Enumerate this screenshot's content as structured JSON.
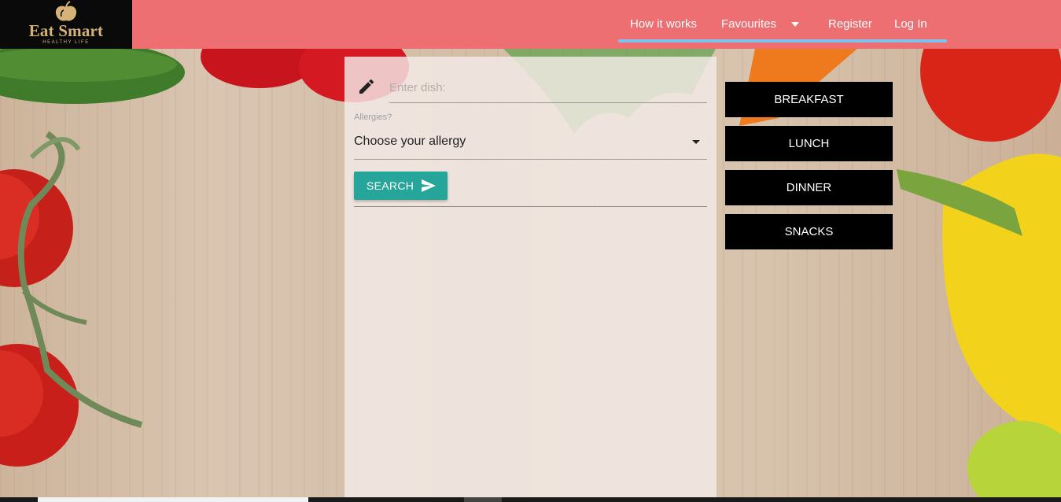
{
  "brand": {
    "name": "Eat Smart",
    "tagline": "HEALTHY LIFE",
    "logo_icon": "apple-icon"
  },
  "nav": {
    "items": [
      {
        "label": "How it works"
      },
      {
        "label": "Favourites",
        "has_dropdown": true
      },
      {
        "label": "Register"
      },
      {
        "label": "Log In"
      }
    ]
  },
  "search_form": {
    "dish_placeholder": "Enter dish:",
    "dish_icon": "pencil-icon",
    "allergy_label": "Allergies?",
    "allergy_value": "Choose your allergy",
    "search_label": "SEARCH",
    "search_icon": "send-icon"
  },
  "meals": [
    {
      "label": "BREAKFAST"
    },
    {
      "label": "LUNCH"
    },
    {
      "label": "DINNER"
    },
    {
      "label": "SNACKS"
    }
  ],
  "colors": {
    "navbar": "#ed6f72",
    "logo_bg": "#0a0a0a",
    "logo_text": "#d4b278",
    "accent_underline": "#7ec3ef",
    "search_button": "#26a69a",
    "meal_button": "#000000"
  }
}
